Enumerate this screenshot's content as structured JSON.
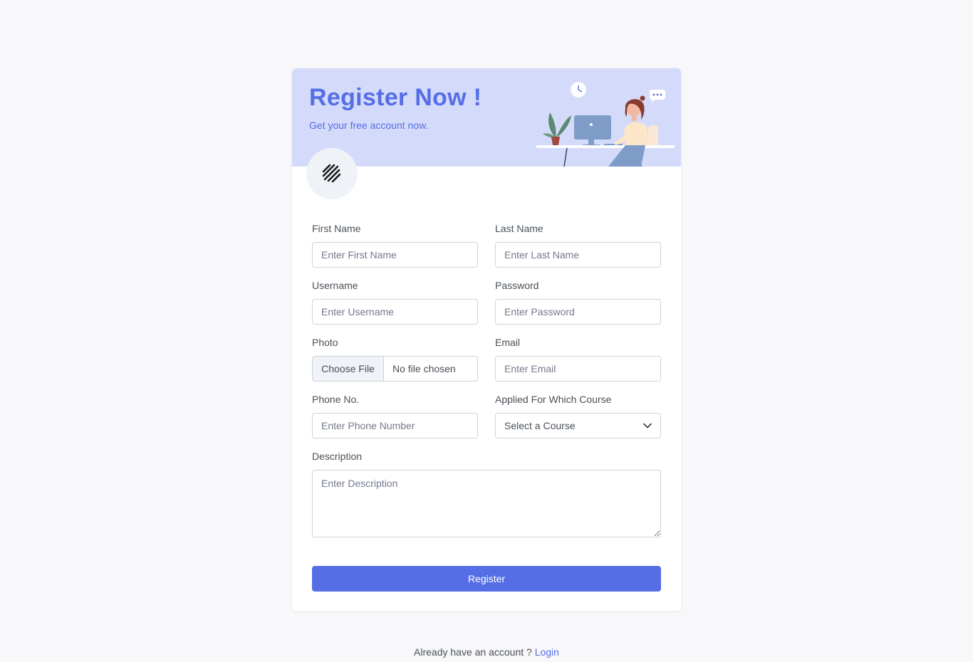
{
  "header": {
    "title": "Register Now !",
    "subtitle": "Get your free account now."
  },
  "colors": {
    "primary": "#556ee6",
    "header_bg": "#d4daf9",
    "page_bg": "#f8f8fa"
  },
  "icons": {
    "logo": "stripes-logo-icon",
    "illustration": "person-at-desk-illustration",
    "select_caret": "chevron-down-icon"
  },
  "form": {
    "first_name": {
      "label": "First Name",
      "placeholder": "Enter First Name"
    },
    "last_name": {
      "label": "Last Name",
      "placeholder": "Enter Last Name"
    },
    "username": {
      "label": "Username",
      "placeholder": "Enter Username"
    },
    "password": {
      "label": "Password",
      "placeholder": "Enter Password"
    },
    "photo": {
      "label": "Photo",
      "button": "Choose File",
      "file_text": "No file chosen"
    },
    "email": {
      "label": "Email",
      "placeholder": "Enter Email"
    },
    "phone": {
      "label": "Phone No.",
      "placeholder": "Enter Phone Number"
    },
    "course": {
      "label": "Applied For Which Course",
      "selected": "Select a Course"
    },
    "description": {
      "label": "Description",
      "placeholder": "Enter Description"
    },
    "submit": "Register"
  },
  "footer": {
    "text": "Already have an account ?",
    "link": "Login"
  }
}
